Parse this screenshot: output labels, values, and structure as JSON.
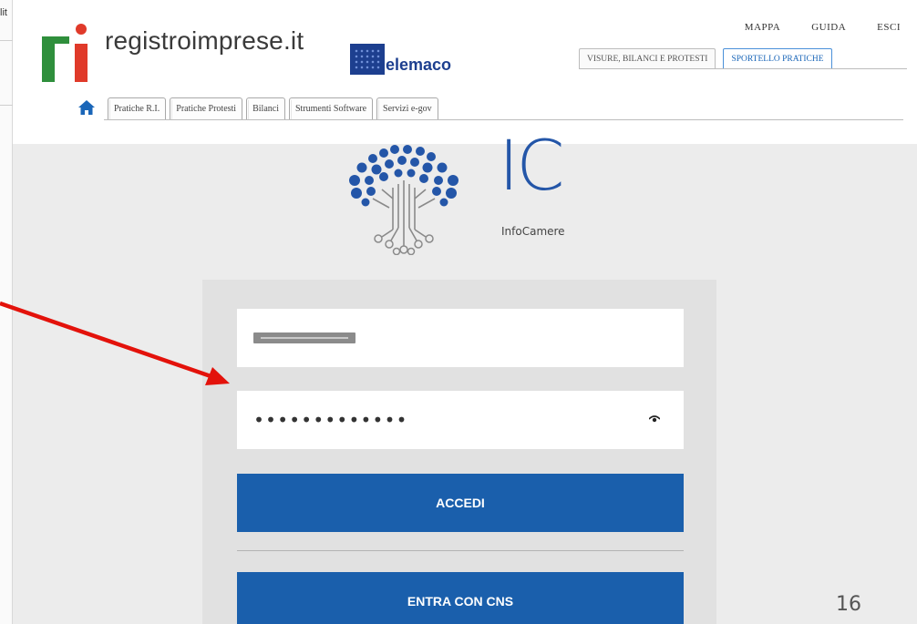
{
  "background": {
    "fragment_text": "lit"
  },
  "header": {
    "logo_text": "registroimprese.it",
    "telemaco_text": "elemaco",
    "top_links": [
      "MAPPA",
      "GUIDA",
      "ESCI"
    ],
    "right_tabs": [
      {
        "label": "VISURE, BILANCI E PROTESTI",
        "active": false
      },
      {
        "label": "SPORTELLO PRATICHE",
        "active": true
      }
    ],
    "nav_tabs": [
      "Pratiche R.I.",
      "Pratiche Protesti",
      "Bilanci",
      "Strumenti Software",
      "Servizi e-gov"
    ]
  },
  "brand": {
    "letters": "IC",
    "name": "InfoCamere"
  },
  "login": {
    "password_mask": "•••••••••••••",
    "accedi_label": "ACCEDI",
    "cns_label": "ENTRA CON CNS"
  },
  "slide": {
    "page_number": "16"
  },
  "colors": {
    "primary_button": "#1a5fac",
    "brand_blue": "#2456a8",
    "arrow": "#e3120b",
    "logo_red": "#e03a2a",
    "logo_green": "#2f8f3c"
  },
  "icons": [
    "home-icon",
    "eye-icon",
    "infocamere-tree-icon",
    "registroimprese-logo-icon",
    "telemaco-icon"
  ]
}
